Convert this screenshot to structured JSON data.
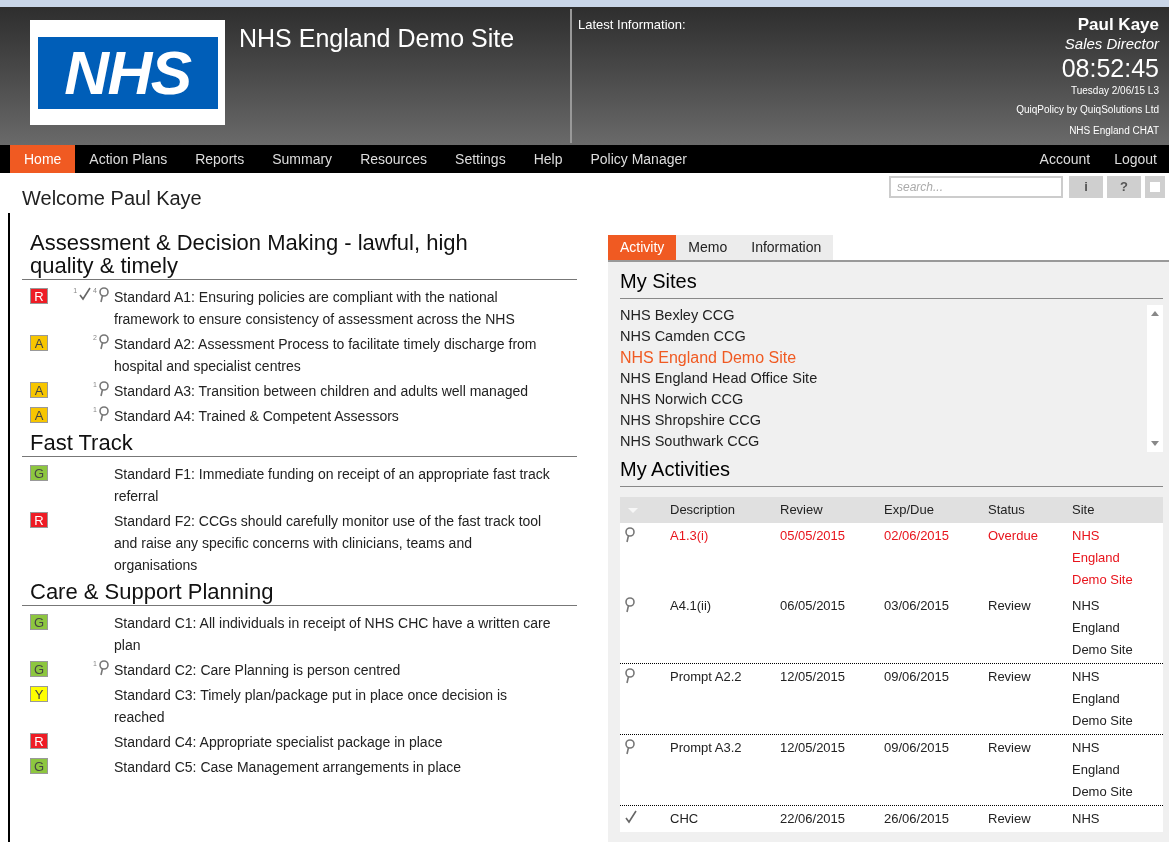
{
  "header": {
    "logo": "NHS",
    "site_title": "NHS England Demo Site",
    "latest_label": "Latest Information:",
    "user_name": "Paul Kaye",
    "user_role": "Sales Director",
    "time": "08:52:45",
    "date": "Tuesday 2/06/15 L3",
    "vendor": "QuiqPolicy by QuiqSolutions Ltd",
    "chat": "NHS England CHAT"
  },
  "nav": {
    "items": [
      {
        "label": "Home",
        "selected": true
      },
      {
        "label": "Action Plans",
        "selected": false
      },
      {
        "label": "Reports",
        "selected": false
      },
      {
        "label": "Summary",
        "selected": false
      },
      {
        "label": "Resources",
        "selected": false
      },
      {
        "label": "Settings",
        "selected": false
      },
      {
        "label": "Help",
        "selected": false
      },
      {
        "label": "Policy Manager",
        "selected": false
      }
    ],
    "right_items": [
      {
        "label": "Account",
        "selected": false
      },
      {
        "label": "Logout",
        "selected": false
      }
    ]
  },
  "welcome": "Welcome Paul Kaye",
  "search": {
    "placeholder": "search..."
  },
  "tool_buttons": [
    "i",
    "?"
  ],
  "sections": [
    {
      "title": "Assessment & Decision Making - lawful, high quality & timely",
      "standards": [
        {
          "rag": "R",
          "color": "#ee1c25",
          "markers": [
            {
              "kind": "check",
              "count": "1"
            },
            {
              "kind": "pin",
              "count": "4"
            }
          ],
          "text": "Standard A1: Ensuring policies are compliant with the national framework to ensure consistency of assessment across the NHS"
        },
        {
          "rag": "A",
          "color": "#f7c600",
          "markers": [
            {
              "kind": "pin",
              "count": "2"
            }
          ],
          "text": "Standard A2: Assessment Process to facilitate timely discharge from hospital and specialist centres"
        },
        {
          "rag": "A",
          "color": "#f7c600",
          "markers": [
            {
              "kind": "pin",
              "count": "1"
            }
          ],
          "text": "Standard A3: Transition between children and adults well managed"
        },
        {
          "rag": "A",
          "color": "#f7c600",
          "markers": [
            {
              "kind": "pin",
              "count": "1"
            }
          ],
          "text": "Standard A4: Trained & Competent Assessors"
        }
      ]
    },
    {
      "title": "Fast Track",
      "standards": [
        {
          "rag": "G",
          "color": "#8dc63f",
          "text": "Standard F1: Immediate funding on receipt of an appropriate fast track referral"
        },
        {
          "rag": "R",
          "color": "#ee1c25",
          "text": "Standard F2: CCGs should carefully monitor use of the fast track tool and raise any specific concerns with clinicians, teams and organisations"
        }
      ]
    },
    {
      "title": "Care & Support Planning",
      "standards": [
        {
          "rag": "G",
          "color": "#8dc63f",
          "text": "Standard C1: All individuals in receipt of NHS CHC have a written care plan"
        },
        {
          "rag": "G",
          "color": "#8dc63f",
          "markers": [
            {
              "kind": "pin",
              "count": "1"
            }
          ],
          "text": "Standard C2: Care Planning is person centred"
        },
        {
          "rag": "Y",
          "color": "#ffff00",
          "text": "Standard C3: Timely plan/package put in place once decision is reached"
        },
        {
          "rag": "R",
          "color": "#ee1c25",
          "text": "Standard C4: Appropriate specialist package in place"
        },
        {
          "rag": "G",
          "color": "#8dc63f",
          "text": "Standard C5: Case Management arrangements in place"
        }
      ]
    }
  ],
  "panel": {
    "tabs": [
      {
        "label": "Activity",
        "selected": true
      },
      {
        "label": "Memo",
        "selected": false
      },
      {
        "label": "Information",
        "selected": false
      }
    ],
    "sites_title": "My Sites",
    "sites": [
      {
        "name": "NHS Bexley CCG",
        "selected": false
      },
      {
        "name": "NHS Camden CCG",
        "selected": false
      },
      {
        "name": "NHS England Demo Site",
        "selected": true
      },
      {
        "name": "NHS England Head Office Site",
        "selected": false
      },
      {
        "name": "NHS Norwich CCG",
        "selected": false
      },
      {
        "name": "NHS Shropshire CCG",
        "selected": false
      },
      {
        "name": "NHS Southwark CCG",
        "selected": false
      }
    ],
    "activities_title": "My Activities",
    "columns": [
      "Description",
      "Review",
      "Exp/Due",
      "Status",
      "Site"
    ],
    "rows": [
      {
        "kind": "pin",
        "overdue": true,
        "cells": [
          "A1.3(i)",
          "05/05/2015",
          "02/06/2015",
          "Overdue",
          "NHS England Demo Site"
        ]
      },
      {
        "kind": "pin",
        "overdue": false,
        "cells": [
          "A4.1(ii)",
          "06/05/2015",
          "03/06/2015",
          "Review",
          "NHS England Demo Site"
        ]
      },
      {
        "kind": "pin",
        "overdue": false,
        "cells": [
          "Prompt A2.2",
          "12/05/2015",
          "09/06/2015",
          "Review",
          "NHS England Demo Site"
        ]
      },
      {
        "kind": "pin",
        "overdue": false,
        "cells": [
          "Prompt A3.2",
          "12/05/2015",
          "09/06/2015",
          "Review",
          "NHS England Demo Site"
        ]
      },
      {
        "kind": "check",
        "overdue": false,
        "cells": [
          "CHC",
          "22/06/2015",
          "26/06/2015",
          "Review",
          "NHS"
        ]
      }
    ]
  }
}
